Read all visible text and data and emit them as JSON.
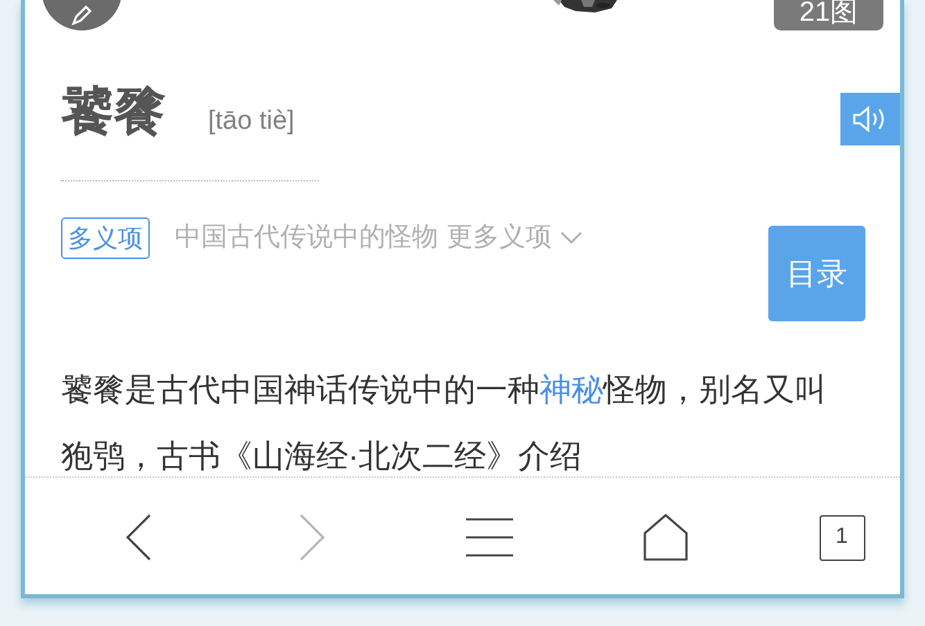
{
  "header": {
    "photo_count": "21图"
  },
  "entry": {
    "title": "饕餮",
    "pinyin": "[tāo tiè]"
  },
  "polysemy": {
    "tag": "多义项",
    "current": "中国古代传说中的怪物",
    "more": "更多义项"
  },
  "toc_button": "目录",
  "summary": [
    {
      "text": "饕餮是古代中国神话传说中的一种",
      "link": false
    },
    {
      "text": "神秘",
      "link": true
    },
    {
      "text": "怪物，别名又叫狍鸮，古书《山海经·北次二经》介绍",
      "link": false
    }
  ],
  "nav": [
    {
      "kind": "back",
      "disabled": false
    },
    {
      "kind": "forward",
      "disabled": true
    },
    {
      "kind": "menu",
      "disabled": false
    },
    {
      "kind": "home",
      "disabled": false
    },
    {
      "kind": "tabs",
      "disabled": false,
      "count": "1"
    }
  ]
}
